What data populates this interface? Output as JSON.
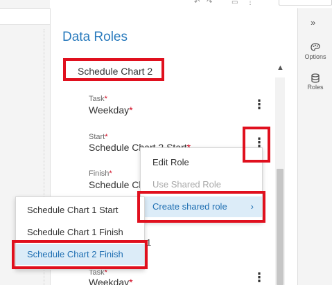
{
  "pane": {
    "title": "Data Roles",
    "section_title": "Schedule Chart 2",
    "roles": [
      {
        "label": "Task",
        "value": "Weekday"
      },
      {
        "label": "Start",
        "value": "Schedule Chart 2 Start"
      },
      {
        "label": "Finish",
        "value": "Schedule Ch"
      }
    ],
    "partial_value": "1",
    "lower_role": {
      "label": "Task",
      "value": "Weekday"
    },
    "required_mark": "*"
  },
  "sidebar": {
    "expand_icon": "double-chevron-right-icon",
    "items": [
      {
        "label": "Options",
        "icon": "paint-palette-icon"
      },
      {
        "label": "Roles",
        "icon": "database-icon"
      }
    ]
  },
  "context_menu": {
    "items": [
      {
        "label": "Edit Role",
        "state": "enabled"
      },
      {
        "label": "Use Shared Role",
        "state": "disabled"
      },
      {
        "label": "Create shared role",
        "state": "active",
        "has_submenu": true
      }
    ]
  },
  "submenu": {
    "items": [
      {
        "label": "Schedule Chart 1 Start"
      },
      {
        "label": "Schedule Chart 1 Finish"
      },
      {
        "label": "Schedule Chart 2 Finish",
        "state": "active"
      }
    ]
  },
  "colors": {
    "accent": "#2a7bbd",
    "highlight": "#e0101e",
    "required": "#d0021b",
    "selection_bg": "#dcecf8"
  }
}
